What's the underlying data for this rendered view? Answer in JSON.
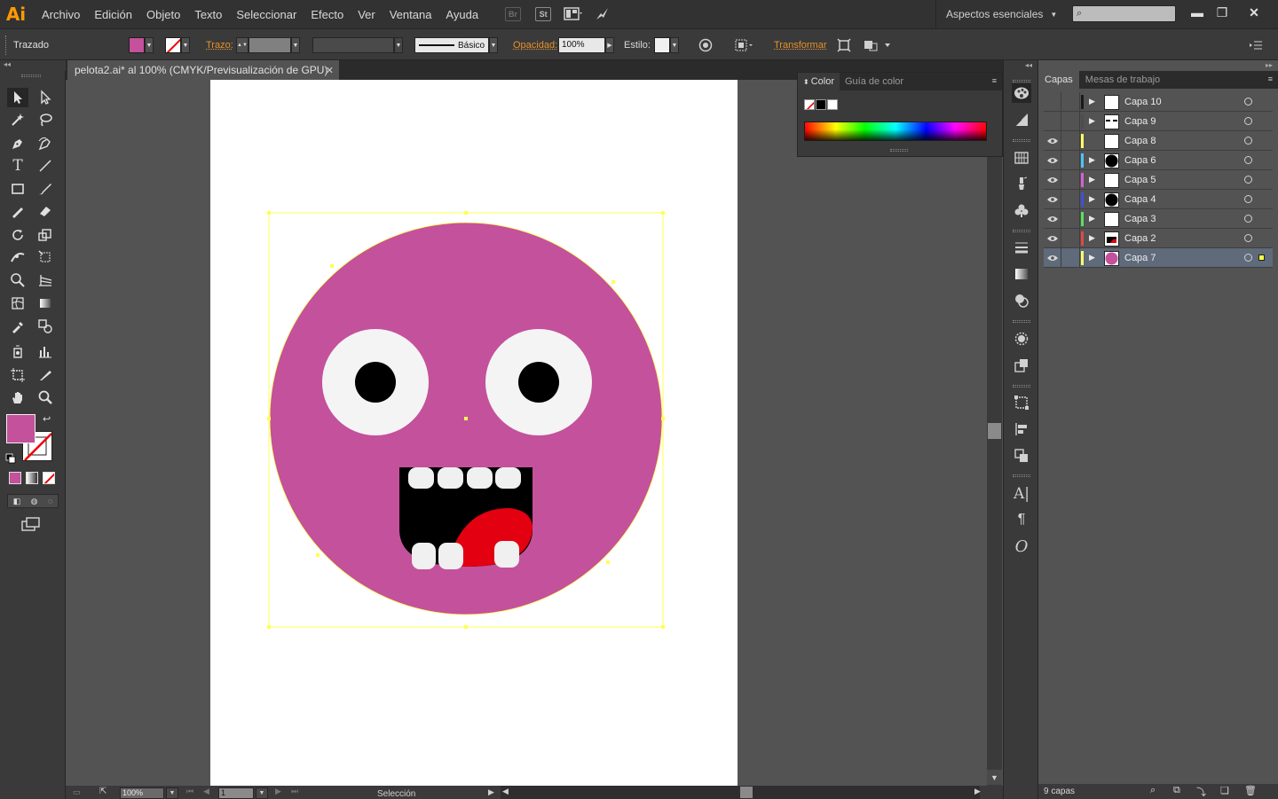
{
  "app": {
    "logo": "Ai",
    "accent": "#ff9a00"
  },
  "menu": [
    "Archivo",
    "Edición",
    "Objeto",
    "Texto",
    "Seleccionar",
    "Efecto",
    "Ver",
    "Ventana",
    "Ayuda"
  ],
  "menu_icons": {
    "br": "Br",
    "st": "St"
  },
  "workspace": {
    "label": "Aspectos esenciales"
  },
  "control": {
    "mode_label": "Trazado",
    "fill_color": "#c4519b",
    "stroke_label": "Trazo:",
    "stroke_profile": "Básico",
    "opacity_label": "Opacidad:",
    "opacity_value": "100%",
    "style_label": "Estilo:",
    "transform_label": "Transformar"
  },
  "document": {
    "tab_title": "pelota2.ai* al 100% (CMYK/Previsualización de GPU)"
  },
  "status": {
    "zoom": "100%",
    "page": "1",
    "tool": "Selección"
  },
  "color_panel": {
    "tabs": [
      "Color",
      "Guía de color"
    ]
  },
  "layers_panel": {
    "tabs": [
      "Capas",
      "Mesas de trabajo"
    ],
    "count_label": "9 capas",
    "layers": [
      {
        "name": "Capa 10",
        "visible": false,
        "color": "#1a1a1a",
        "expandable": true,
        "thumb": "blank",
        "selected": false
      },
      {
        "name": "Capa 9",
        "visible": false,
        "color": "#4d4d4d",
        "expandable": true,
        "thumb": "brows",
        "selected": false
      },
      {
        "name": "Capa 8",
        "visible": true,
        "color": "#ffff66",
        "expandable": false,
        "thumb": "blank",
        "selected": false
      },
      {
        "name": "Capa 6",
        "visible": true,
        "color": "#4fc3f7",
        "expandable": true,
        "thumb": "black-circle",
        "selected": false
      },
      {
        "name": "Capa 5",
        "visible": true,
        "color": "#d65fd6",
        "expandable": true,
        "thumb": "blank",
        "selected": false
      },
      {
        "name": "Capa 4",
        "visible": true,
        "color": "#3f51d8",
        "expandable": true,
        "thumb": "black-circle",
        "selected": false
      },
      {
        "name": "Capa 3",
        "visible": true,
        "color": "#5be05b",
        "expandable": true,
        "thumb": "blank",
        "selected": false
      },
      {
        "name": "Capa 2",
        "visible": true,
        "color": "#e04848",
        "expandable": true,
        "thumb": "mouth",
        "selected": false
      },
      {
        "name": "Capa 7",
        "visible": true,
        "color": "#ffff66",
        "expandable": true,
        "thumb": "pink-circle",
        "selected": true
      }
    ]
  },
  "artwork": {
    "face_color": "#c4519b",
    "eye_white": "#f4f4f4",
    "pupil": "#000000",
    "mouth": "#000000",
    "tongue": "#e30010",
    "teeth": "#f0f0f0",
    "selection_color": "#ffff55"
  }
}
